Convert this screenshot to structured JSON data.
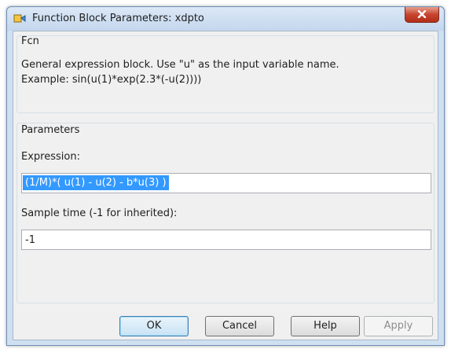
{
  "window": {
    "title": "Function Block Parameters: xdpto"
  },
  "block": {
    "group_label": "Fcn",
    "description_line1": "General expression block. Use \"u\" as the input variable name.",
    "description_line2": "Example: sin(u(1)*exp(2.3*(-u(2))))"
  },
  "parameters": {
    "group_label": "Parameters",
    "expression_label": "Expression:",
    "expression_value": "(1/M)*( u(1) - u(2) - b*u(3) )",
    "sample_time_label": "Sample time (-1 for inherited):",
    "sample_time_value": "-1"
  },
  "buttons": {
    "ok": "OK",
    "cancel": "Cancel",
    "help": "Help",
    "apply": "Apply"
  },
  "colors": {
    "selection": "#3399ff",
    "close_button": "#c7442e",
    "titlebar": "#cfe0f1"
  }
}
